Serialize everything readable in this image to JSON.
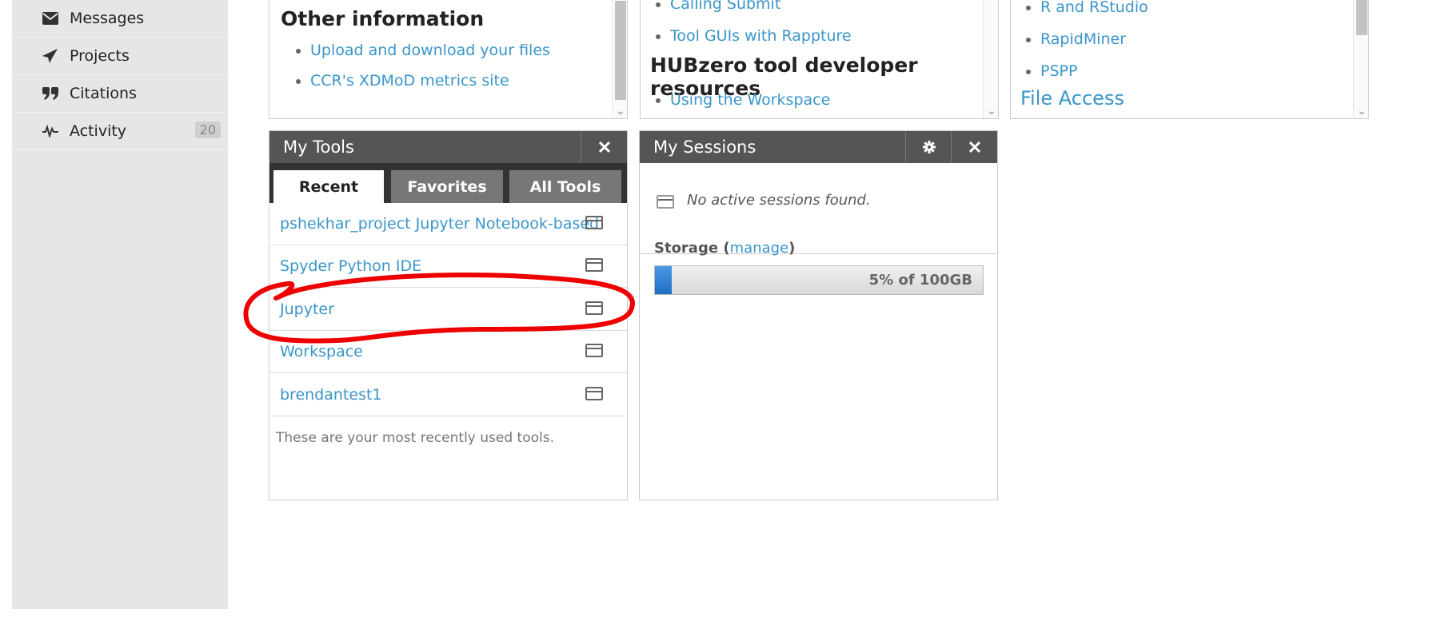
{
  "sidebar": {
    "items": [
      {
        "label": "Messages",
        "icon": "envelope-icon"
      },
      {
        "label": "Projects",
        "icon": "paper-plane-icon"
      },
      {
        "label": "Citations",
        "icon": "quote-icon"
      },
      {
        "label": "Activity",
        "icon": "activity-icon",
        "badge": "20"
      }
    ]
  },
  "panels": {
    "other_info": {
      "title": "Other information",
      "links": [
        "Upload and download your files",
        "CCR's XDMoD metrics site"
      ]
    },
    "developer": {
      "links_top": [
        "Calling Submit",
        "Tool GUIs with Rappture"
      ],
      "heading": "HUBzero tool developer resources",
      "links_bottom": [
        "Using the Workspace"
      ]
    },
    "software": {
      "links": [
        "R and RStudio",
        "RapidMiner",
        "PSPP"
      ],
      "section_link": "File Access"
    }
  },
  "my_tools": {
    "title": "My Tools",
    "tabs": [
      "Recent",
      "Favorites",
      "All Tools"
    ],
    "active_tab": "Recent",
    "tools": [
      "pshekhar_project Jupyter Notebook-based",
      "Spyder Python IDE",
      "Jupyter",
      "Workspace",
      "brendantest1"
    ],
    "footer": "These are your most recently used tools."
  },
  "my_sessions": {
    "title": "My Sessions",
    "empty_text": "No active sessions found.",
    "storage_label": "Storage",
    "storage_manage": "manage",
    "storage_percent": 5,
    "storage_text": "5% of 100GB"
  },
  "colors": {
    "link": "#3a95c9",
    "header": "#555555",
    "annotation": "#ee0000",
    "storage_fill": "#1e6fc4"
  }
}
